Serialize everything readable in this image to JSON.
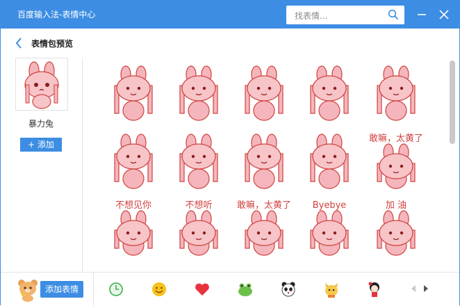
{
  "window": {
    "title": "百度输入法-表情中心"
  },
  "search": {
    "placeholder": "找表情..."
  },
  "header": {
    "subtitle": "表情包预览"
  },
  "pack": {
    "name": "暴力兔",
    "add_label": "+ 添加"
  },
  "stickers": [
    {
      "name": "sticker-1",
      "caption": ""
    },
    {
      "name": "sticker-2",
      "caption": ""
    },
    {
      "name": "sticker-3",
      "caption": ""
    },
    {
      "name": "sticker-4",
      "caption": ""
    },
    {
      "name": "sticker-5",
      "caption": ""
    },
    {
      "name": "sticker-6",
      "caption": ""
    },
    {
      "name": "sticker-7",
      "caption": ""
    },
    {
      "name": "sticker-8",
      "caption": ""
    },
    {
      "name": "sticker-9",
      "caption": ""
    },
    {
      "name": "sticker-10",
      "caption": "敢嘛，太黄了"
    },
    {
      "name": "sticker-11",
      "caption": "不想见你"
    },
    {
      "name": "sticker-12",
      "caption": "不想听"
    },
    {
      "name": "sticker-13",
      "caption": "敢嘛，太黄了"
    },
    {
      "name": "sticker-14",
      "caption": "Byebye"
    },
    {
      "name": "sticker-15",
      "caption": "加 油"
    }
  ],
  "footer": {
    "add_pack_label": "添加表情"
  },
  "category_tabs": [
    "clock-icon",
    "smiley-icon",
    "heart-icon",
    "frog-icon",
    "panda-icon",
    "fox-icon",
    "girl-icon"
  ],
  "colors": {
    "accent": "#3c8de3",
    "bunny": "#f4b6bc",
    "outline": "#d0413f"
  }
}
